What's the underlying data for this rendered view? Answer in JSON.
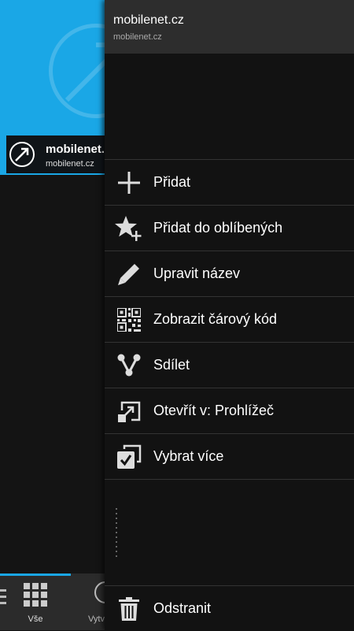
{
  "tile": {
    "title": "mobilenet.c",
    "subtitle": "mobilenet.cz",
    "icon": "compass-logo-icon"
  },
  "bottom_bar": {
    "tab_all_label": "Vše",
    "tab_create_label": "Vytv",
    "accent": "#1aa7e6"
  },
  "menu": {
    "header_title": "mobilenet.cz",
    "header_subtitle": "mobilenet.cz",
    "items": [
      {
        "label": "Přidat",
        "icon": "plus-icon"
      },
      {
        "label": "Přidat do oblíbených",
        "icon": "star-add-icon"
      },
      {
        "label": "Upravit název",
        "icon": "pencil-icon"
      },
      {
        "label": "Zobrazit čárový kód",
        "icon": "qr-code-icon"
      },
      {
        "label": "Sdílet",
        "icon": "share-icon"
      },
      {
        "label": "Otevřít v: Prohlížeč",
        "icon": "open-in-icon"
      },
      {
        "label": "Vybrat více",
        "icon": "select-multiple-icon"
      }
    ],
    "footer": {
      "label": "Odstranit",
      "icon": "trash-icon"
    }
  }
}
